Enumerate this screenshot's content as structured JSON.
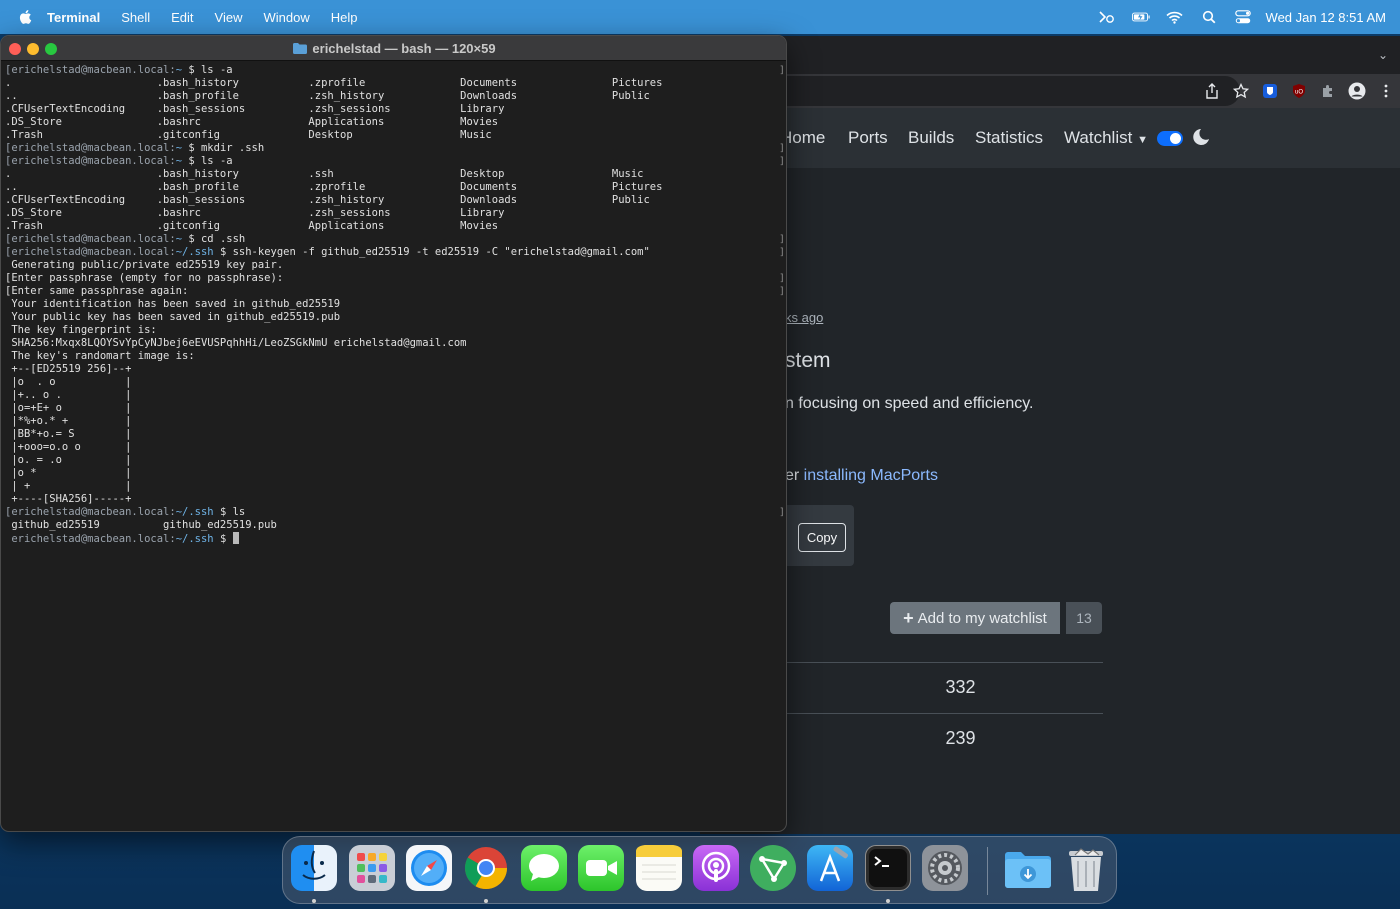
{
  "menubar": {
    "app_name": "Terminal",
    "items": [
      "Shell",
      "Edit",
      "View",
      "Window",
      "Help"
    ],
    "clock": "Wed Jan 12  8:51 AM"
  },
  "terminal": {
    "title": "erichelstad — bash — 120×59",
    "lines": [
      {
        "prompt": "[erichelstad@macbean.local:",
        "path": "~",
        "cmd": " $ ls -a"
      },
      {
        "text": ".                       .bash_history           .zprofile               Documents               Pictures"
      },
      {
        "text": "..                      .bash_profile           .zsh_history            Downloads               Public"
      },
      {
        "text": ".CFUserTextEncoding     .bash_sessions          .zsh_sessions           Library"
      },
      {
        "text": ".DS_Store               .bashrc                 Applications            Movies"
      },
      {
        "text": ".Trash                  .gitconfig              Desktop                 Music"
      },
      {
        "prompt": "[erichelstad@macbean.local:",
        "path": "~",
        "cmd": " $ mkdir .ssh"
      },
      {
        "prompt": "[erichelstad@macbean.local:",
        "path": "~",
        "cmd": " $ ls -a"
      },
      {
        "text": ".                       .bash_history           .ssh                    Desktop                 Music"
      },
      {
        "text": "..                      .bash_profile           .zprofile               Documents               Pictures"
      },
      {
        "text": ".CFUserTextEncoding     .bash_sessions          .zsh_history            Downloads               Public"
      },
      {
        "text": ".DS_Store               .bashrc                 .zsh_sessions           Library"
      },
      {
        "text": ".Trash                  .gitconfig              Applications            Movies"
      },
      {
        "prompt": "[erichelstad@macbean.local:",
        "path": "~",
        "cmd": " $ cd .ssh"
      },
      {
        "prompt": "[erichelstad@macbean.local:",
        "path": "~/.ssh",
        "cmd": " $ ssh-keygen -f github_ed25519 -t ed25519 -C \"erichelstad@gmail.com\""
      },
      {
        "text": " Generating public/private ed25519 key pair."
      },
      {
        "text": "[Enter passphrase (empty for no passphrase):"
      },
      {
        "text": "[Enter same passphrase again:"
      },
      {
        "text": " Your identification has been saved in github_ed25519"
      },
      {
        "text": " Your public key has been saved in github_ed25519.pub"
      },
      {
        "text": " The key fingerprint is:"
      },
      {
        "text": " SHA256:Mxqx8LQOYSvYpCyNJbej6eEVUSPqhhHi/LeoZSGkNmU erichelstad@gmail.com"
      },
      {
        "text": " The key's randomart image is:"
      },
      {
        "text": " +--[ED25519 256]--+"
      },
      {
        "text": " |o  . o           |"
      },
      {
        "text": " |+.. o .          |"
      },
      {
        "text": " |o=+E+ o          |"
      },
      {
        "text": " |*%+o.* +         |"
      },
      {
        "text": " |BB*+o.= S        |"
      },
      {
        "text": " |+ooo=o.o o       |"
      },
      {
        "text": " |o. = .o          |"
      },
      {
        "text": " |o *              |"
      },
      {
        "text": " | +               |"
      },
      {
        "text": " +----[SHA256]-----+"
      },
      {
        "prompt": "[erichelstad@macbean.local:",
        "path": "~/.ssh",
        "cmd": " $ ls"
      },
      {
        "text": " github_ed25519          github_ed25519.pub"
      },
      {
        "prompt": " erichelstad@macbean.local:",
        "path": "~/.ssh",
        "cmd": " $ ",
        "cursor": true
      }
    ]
  },
  "browser": {
    "nav": {
      "home": "Home",
      "ports": "Ports",
      "builds": "Builds",
      "statistics": "Statistics",
      "watchlist": "Watchlist"
    },
    "updated_text": "ks ago",
    "port_title": "stem",
    "port_desc": "n focusing on speed and efficiency.",
    "install_prefix": "er ",
    "install_link": "installing MacPorts",
    "copy_label": "Copy",
    "watch_label": "Add to my watchlist",
    "watch_count": "13",
    "stat_1": "332",
    "stat_2": "239",
    "colors": {
      "accent": "#0d6efd",
      "bg": "#212529",
      "navbar": "#2b3035"
    }
  },
  "dock": {
    "apps": [
      "finder-icon",
      "launchpad-icon",
      "safari-icon",
      "chrome-icon",
      "messages-icon",
      "facetime-icon",
      "notes-icon",
      "podcasts-icon",
      "vector-app-icon",
      "xcode-icon",
      "terminal-icon",
      "system-preferences-icon",
      "downloads-folder-icon",
      "trash-icon"
    ]
  }
}
